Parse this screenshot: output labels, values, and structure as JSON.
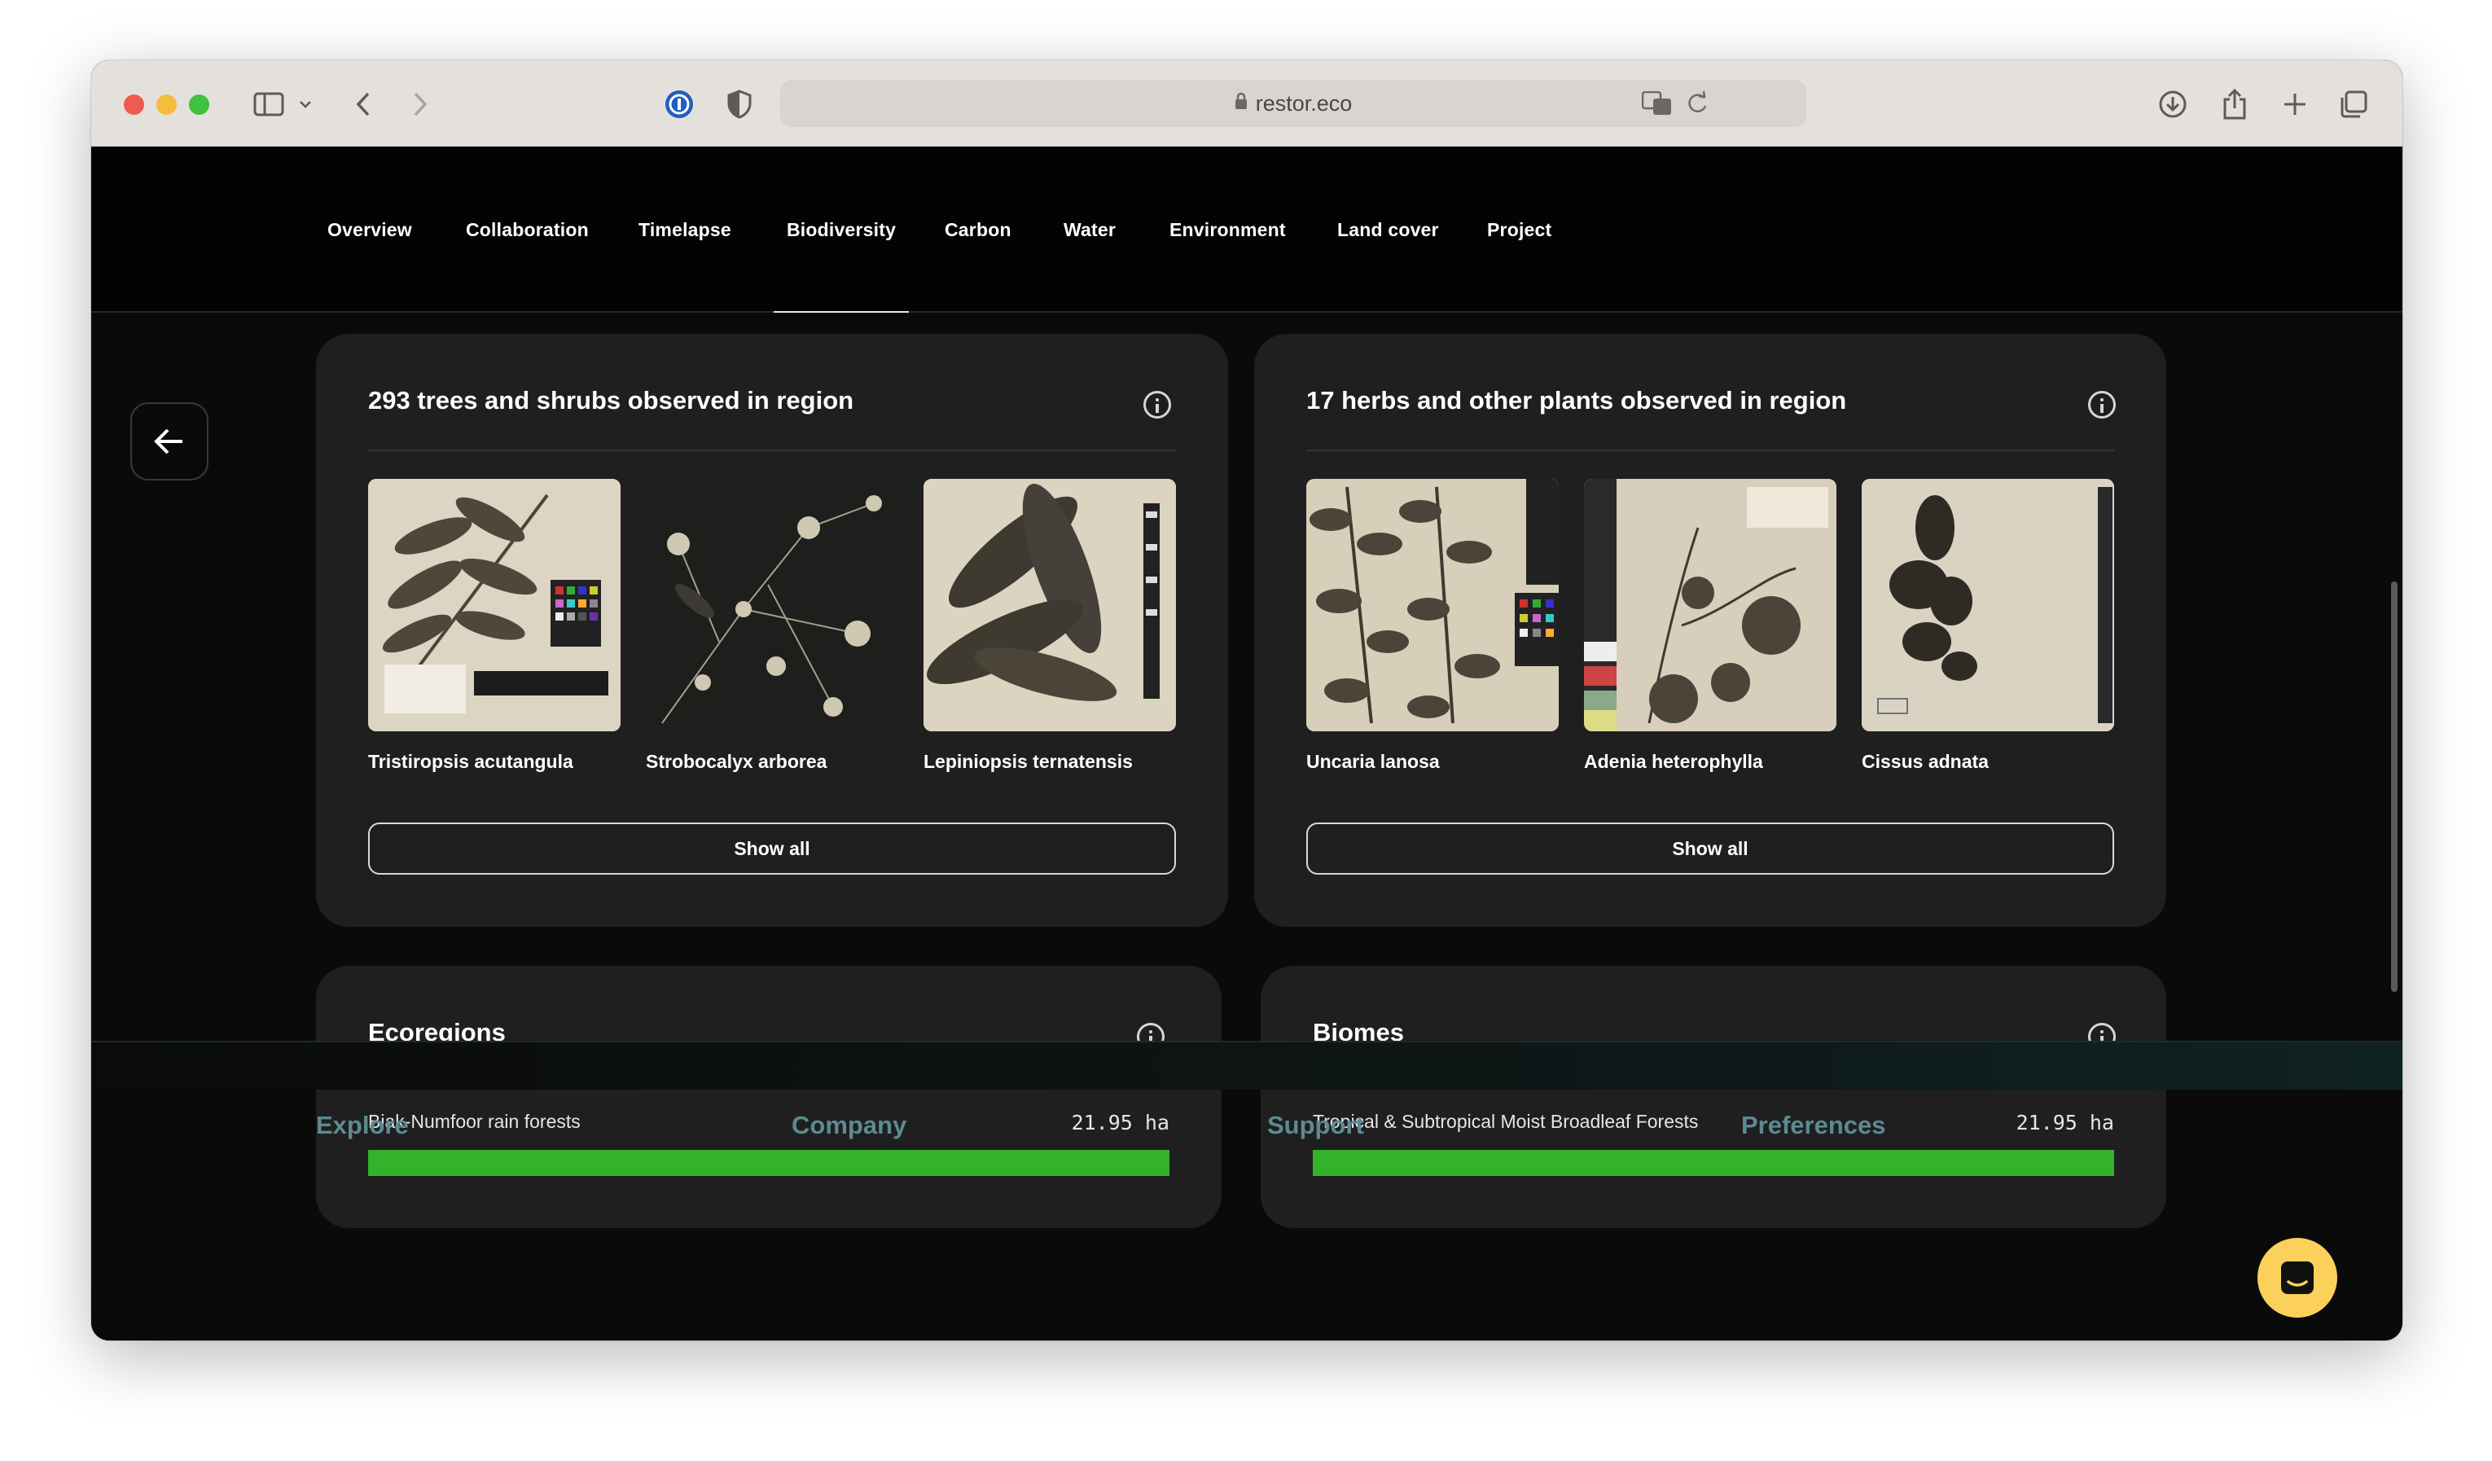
{
  "browser": {
    "url": "restor.eco"
  },
  "nav": {
    "items": [
      {
        "label": "Overview"
      },
      {
        "label": "Collaboration"
      },
      {
        "label": "Timelapse"
      },
      {
        "label": "Biodiversity",
        "active": true
      },
      {
        "label": "Carbon"
      },
      {
        "label": "Water"
      },
      {
        "label": "Environment"
      },
      {
        "label": "Land cover"
      },
      {
        "label": "Project"
      }
    ]
  },
  "trees_card": {
    "title": "293 trees and shrubs observed in region",
    "species": [
      {
        "name": "Tristiropsis acutangula"
      },
      {
        "name": "Strobocalyx arborea"
      },
      {
        "name": "Lepiniopsis ternatensis"
      }
    ],
    "show_all_label": "Show all"
  },
  "herbs_card": {
    "title": "17 herbs and other plants observed in region",
    "species": [
      {
        "name": "Uncaria lanosa"
      },
      {
        "name": "Adenia heterophylla"
      },
      {
        "name": "Cissus adnata"
      }
    ],
    "show_all_label": "Show all"
  },
  "ecoregions_card": {
    "title": "Ecoregions",
    "rows": [
      {
        "label": "Biak-Numfoor rain forests",
        "value": "21.95 ha",
        "fill_percent": 100
      }
    ]
  },
  "biomes_card": {
    "title": "Biomes",
    "rows": [
      {
        "label": "Tropical & Subtropical Moist Broadleaf Forests",
        "value": "21.95 ha",
        "fill_percent": 100
      }
    ]
  },
  "footer": {
    "columns": [
      {
        "label": "Explore"
      },
      {
        "label": "Company"
      },
      {
        "label": "Support"
      },
      {
        "label": "Preferences"
      }
    ]
  },
  "colors": {
    "bar_fill": "#33b22b",
    "chat_button": "#fbd15b",
    "card_bg": "#1f1f1f",
    "footer_link": "#5d8a93"
  }
}
